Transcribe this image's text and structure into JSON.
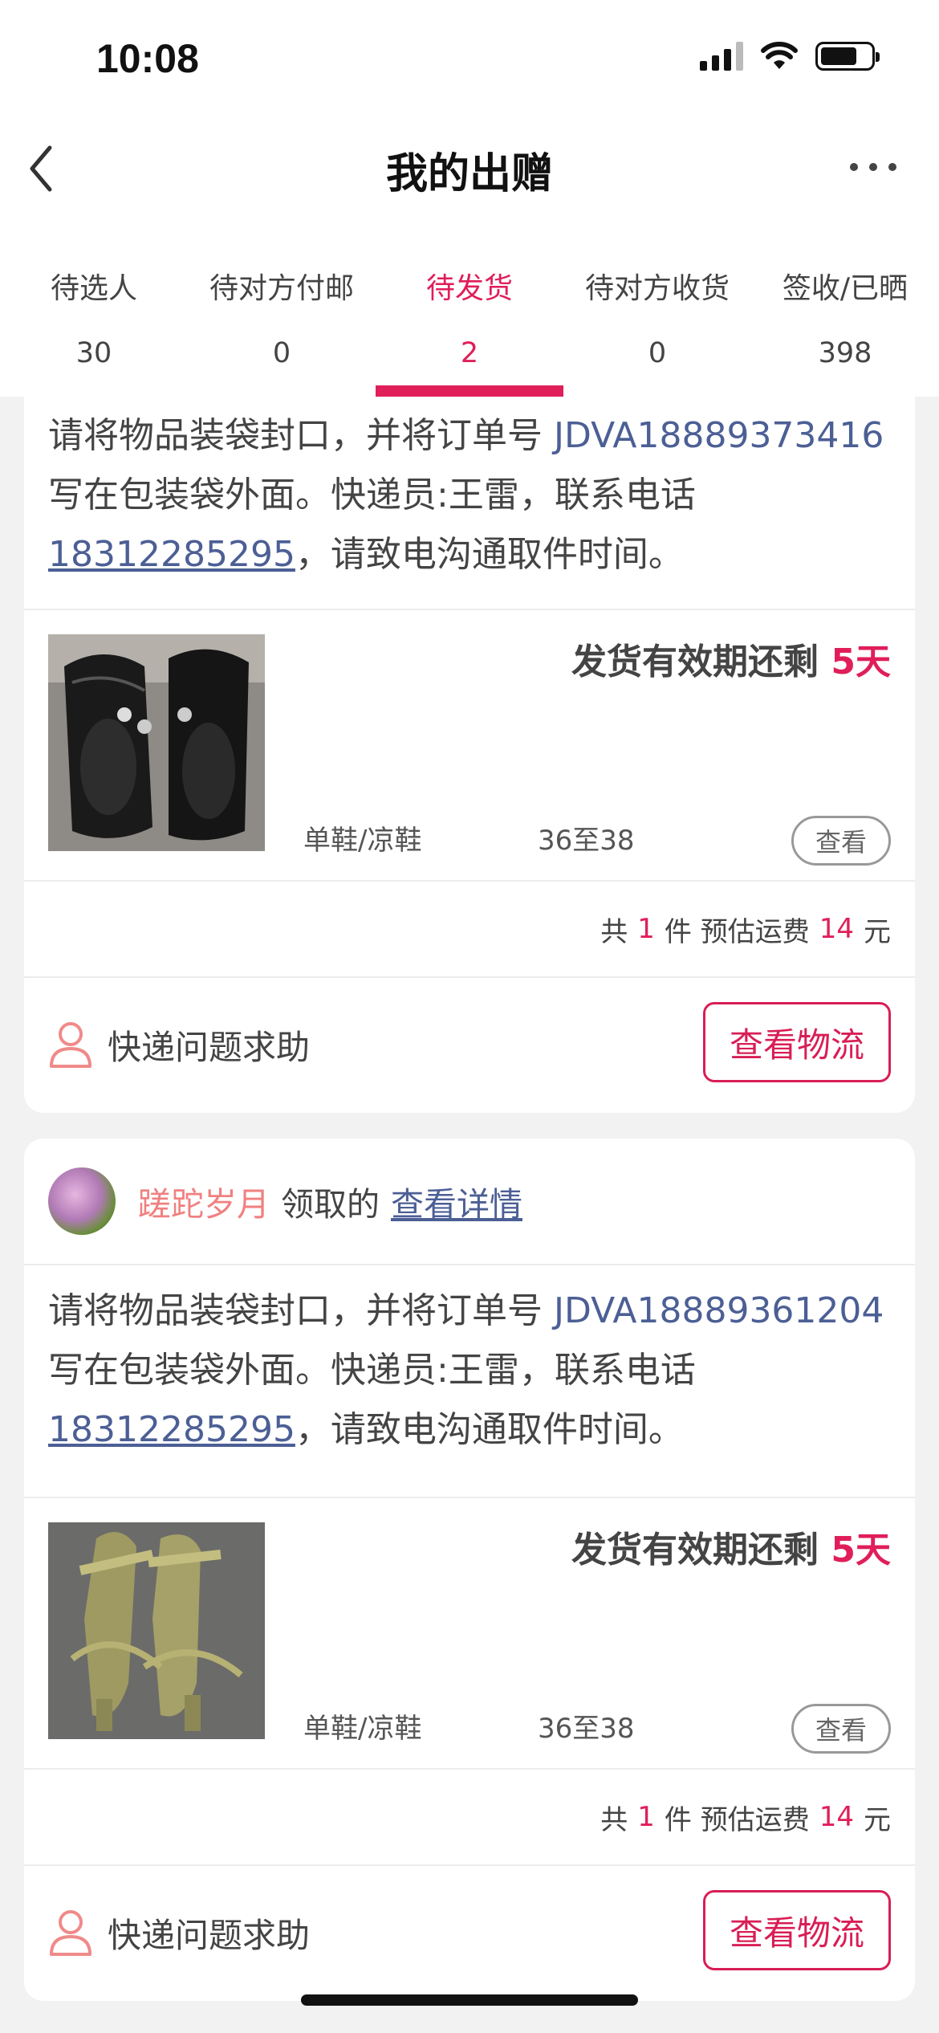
{
  "status": {
    "time": "10:08"
  },
  "nav": {
    "title": "我的出赠"
  },
  "colors": {
    "accent": "#e01e5a",
    "link": "#4c5f95"
  },
  "tabs": [
    {
      "label": "待选人",
      "count": "30"
    },
    {
      "label": "待对方付邮",
      "count": "0"
    },
    {
      "label": "待发货",
      "count": "2",
      "active": true
    },
    {
      "label": "待对方收货",
      "count": "0"
    },
    {
      "label": "签收/已晒",
      "count": "398"
    }
  ],
  "orders": [
    {
      "instr_pre": "请将物品装袋封口，并将订单号 ",
      "order_no": "JDVA18889373416",
      "instr_mid": " 写在包装袋外面。快递员:王雷，联系电话",
      "phone": "18312285295",
      "instr_post": "，请致电沟通取件时间。",
      "deadline_label": "发货有效期还剩 ",
      "deadline_days": "5天",
      "category": "单鞋/凉鞋",
      "size": "36至38",
      "view_label": "查看",
      "sum_pre": "共",
      "sum_count": "1",
      "sum_mid": "件 预估运费",
      "sum_fee": "14",
      "sum_unit": "元",
      "help_label": "快递问题求助",
      "logistics_label": "查看物流",
      "image": "black-leather-shoes"
    },
    {
      "receiver_name": "蹉跎岁月",
      "receiver_text": "领取的",
      "detail_link": "查看详情",
      "instr_pre": "请将物品装袋封口，并将订单号 ",
      "order_no": "JDVA18889361204",
      "instr_mid": " 写在包装袋外面。快递员:王雷，联系电话",
      "phone": "18312285295",
      "instr_post": "，请致电沟通取件时间。",
      "deadline_label": "发货有效期还剩 ",
      "deadline_days": "5天",
      "category": "单鞋/凉鞋",
      "size": "36至38",
      "view_label": "查看",
      "sum_pre": "共",
      "sum_count": "1",
      "sum_mid": "件 预估运费",
      "sum_fee": "14",
      "sum_unit": "元",
      "help_label": "快递问题求助",
      "logistics_label": "查看物流",
      "image": "olive-strappy-sandals"
    }
  ]
}
